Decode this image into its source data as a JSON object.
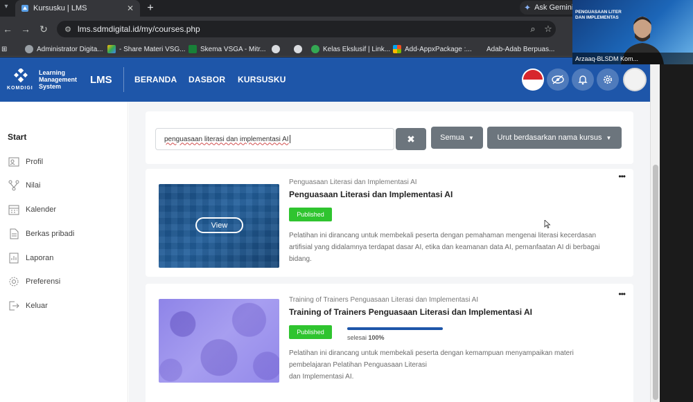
{
  "browser": {
    "tab_title": "Kursusku | LMS",
    "tab_close": "✕",
    "new_tab": "+",
    "gemini_label": "Ask Gemini",
    "url": "lms.sdmdigital.id/my/courses.php",
    "bookmarks": [
      {
        "label": "Administrator Digita...",
        "color": "#5f6368"
      },
      {
        "label": "- Share Materi VSG...",
        "color": "#fbbc04"
      },
      {
        "label": "Skema VSGA - Mitr...",
        "color": "#188038"
      },
      {
        "label": "",
        "color": "#5f6368"
      },
      {
        "label": "",
        "color": "#5f6368"
      },
      {
        "label": "Kelas Ekslusif | Link...",
        "color": "#34a853"
      },
      {
        "label": "Add-AppxPackage :...",
        "color": "#f25022"
      },
      {
        "label": "Adab-Adab Berpuas...",
        "color": "#5f6368"
      }
    ]
  },
  "lms": {
    "brand_word": "KOMDIGI",
    "brand_full": [
      "Learning",
      "Management",
      "System"
    ],
    "brand_short": "LMS",
    "nav": [
      "BERANDA",
      "DASBOR",
      "KURSUSKU"
    ],
    "colors": {
      "primary": "#1e56a9",
      "published": "#2fc42f"
    }
  },
  "sidebar": {
    "title": "Start",
    "items": [
      {
        "label": "Profil",
        "icon": "profile-icon"
      },
      {
        "label": "Nilai",
        "icon": "grades-icon"
      },
      {
        "label": "Kalender",
        "icon": "calendar-icon"
      },
      {
        "label": "Berkas pribadi",
        "icon": "files-icon"
      },
      {
        "label": "Laporan",
        "icon": "reports-icon"
      },
      {
        "label": "Preferensi",
        "icon": "preferences-icon"
      },
      {
        "label": "Keluar",
        "icon": "logout-icon"
      }
    ]
  },
  "filters": {
    "search_value": "penguasaan literasi dan implementasi AI",
    "clear_label": "✖",
    "grouping_label": "Semua",
    "sort_label": "Urut berdasarkan nama kursus"
  },
  "courses": [
    {
      "category": "Penguasaan Literasi dan Implementasi AI",
      "title": "Penguasaan Literasi dan Implementasi AI",
      "status": "Published",
      "view_label": "View",
      "description": [
        "Pelatihan ini dirancang untuk membekali peserta dengan pemahaman mengenai literasi kecerdasan",
        "artifisial yang didalamnya terdapat dasar AI, etika dan keamanan data AI, pemanfaatan AI di berbagai",
        "bidang."
      ],
      "menu": "•••"
    },
    {
      "category": "Training of Trainers Penguasaan Literasi dan Implementasi AI",
      "title": "Training of Trainers Penguasaan Literasi dan Implementasi AI",
      "status": "Published",
      "progress_label": "selesai",
      "progress_value": "100%",
      "progress_fraction": 1.0,
      "description": [
        "Pelatihan ini dirancang untuk membekali peserta dengan kemampuan menyampaikan materi",
        "pembelajaran Pelatihan Penguasaan Literasi",
        "dan Implementasi AI."
      ],
      "menu": "•••"
    }
  ],
  "webcam": {
    "banner_title": [
      "PENGUASAAN LITER",
      "DAN IMPLEMENTAS"
    ],
    "name": "Arzaaq-BLSDM Kom..."
  }
}
